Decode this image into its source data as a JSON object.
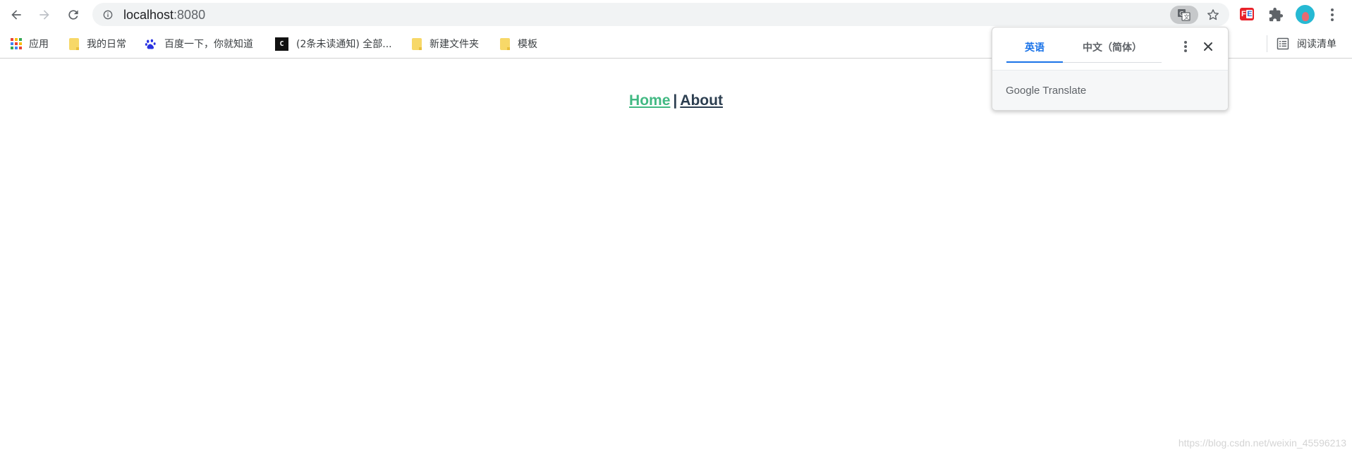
{
  "browser": {
    "address_bar": {
      "host": "localhost",
      "port": ":8080"
    },
    "bookmarks": [
      {
        "label": "应用",
        "icon": "apps-grid-icon"
      },
      {
        "label": "我的日常",
        "icon": "folder-icon"
      },
      {
        "label": "百度一下，你就知道",
        "icon": "baidu-paw-icon"
      },
      {
        "label": "(2条未读通知) 全部...",
        "icon": "csdn-icon"
      },
      {
        "label": "新建文件夹",
        "icon": "folder-icon"
      },
      {
        "label": "模板",
        "icon": "folder-icon"
      }
    ],
    "reading_list": "阅读清单",
    "extension_badge": {
      "left": "F",
      "right": "E"
    }
  },
  "translate_popup": {
    "tab_source": "英语",
    "tab_target": "中文（简体）",
    "brand": "Google Translate"
  },
  "page": {
    "nav": {
      "home": "Home",
      "separator": "|",
      "about": "About"
    }
  },
  "watermark": "https://blog.csdn.net/weixin_45596213",
  "colors": {
    "home_link": "#42b983",
    "about_link": "#2c3e50",
    "translate_active": "#1a73e8"
  }
}
